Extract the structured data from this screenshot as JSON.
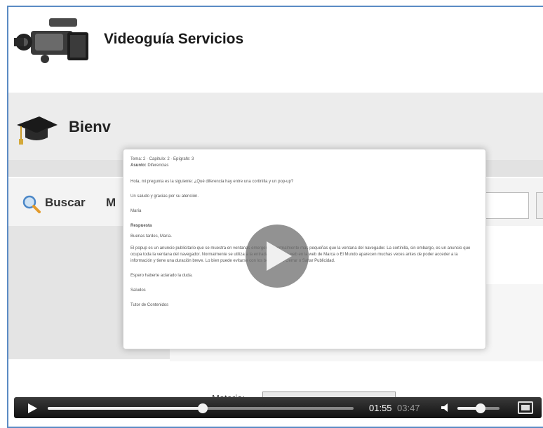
{
  "header": {
    "title": "Videoguía Servicios"
  },
  "background": {
    "welcome_text": "Bienv",
    "search_label": "Buscar",
    "partial_letter": "M",
    "materia_label": "Materia:"
  },
  "card": {
    "header_line": "Tema: 2 · Capítulo: 2 · Epígrafe: 3",
    "subject_label": "Asunto:",
    "subject_value": "Diferencias",
    "question": "Hola, mi pregunta es la siguiente: ¿Qué diferencia hay entre una cortinilla y un pop-up?",
    "thanks": "Un saludo y gracias por su atención.",
    "sign": "María",
    "answer_label": "Respuesta",
    "greeting": "Buenas tardes, María.",
    "answer_body": "El popup es un anuncio publicitario que se muestra en ventanas emergentes normalmente más pequeñas que la ventana del navegador. La cortinilla, sin embargo, es un anuncio que ocupa toda la ventana del navegador. Normalmente se utiliza a la entrada de un sitio web en la web de Marca o El Mundo aparecen muchas veces antes de poder acceder a la información y tiene una duración breve. Lo bien puede evitarse con los botones de Cerrar o Saltar Publicidad.",
    "hope": "Espero haberte aclarado la duda.",
    "bye": "Saludos",
    "signoff": "Tutor de Contenidos"
  },
  "player": {
    "current_time": "01:55",
    "total_time": "03:47",
    "progress": 0.507,
    "volume": 0.55
  }
}
